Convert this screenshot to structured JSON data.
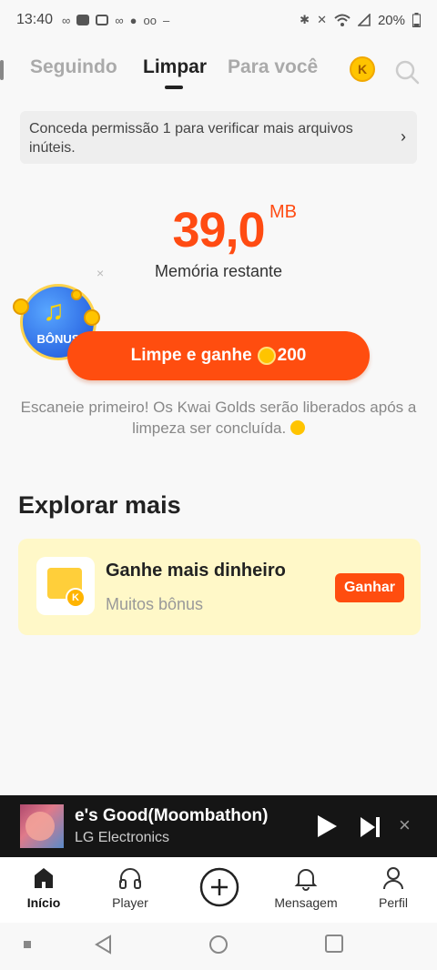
{
  "status_bar": {
    "time": "13:40",
    "battery": "20%"
  },
  "tabs": [
    {
      "label": "Seguindo",
      "active": false
    },
    {
      "label": "Limpar",
      "active": true
    },
    {
      "label": "Para você",
      "active": false
    }
  ],
  "header": {
    "coin_icon": "kwai-coin-icon",
    "coin_letter": "K",
    "search_icon": "search-icon"
  },
  "permission_banner": {
    "text": "Conceda permissão 1 para verificar mais arquivos inúteis.",
    "chevron": "›"
  },
  "memory": {
    "value": "39,0",
    "unit": "MB",
    "label": "Memória restante"
  },
  "bonus_badge": {
    "label": "BÔNUS",
    "icon": "music-note-icon",
    "dismiss": "×"
  },
  "clean_button": {
    "label": "Limpe e ganhe",
    "amount": "200"
  },
  "scan_note": "Escaneie primeiro! Os Kwai Golds serão liberados após a limpeza ser concluída.",
  "explore": {
    "title": "Explorar mais",
    "card": {
      "title": "Ganhe mais dinheiro",
      "subtitle": "Muitos bônus",
      "button": "Ganhar",
      "coin_letter": "K"
    }
  },
  "player": {
    "song": "e's Good(Moombathon)",
    "artist": "LG Electronics",
    "close": "×"
  },
  "bottom_nav": [
    {
      "label": "Início",
      "icon": "home-icon",
      "active": true
    },
    {
      "label": "Player",
      "icon": "headphones-icon",
      "active": false
    },
    {
      "label": "Mensagem",
      "icon": "bell-icon",
      "active": false
    },
    {
      "label": "Perfil",
      "icon": "person-icon",
      "active": false
    }
  ],
  "colors": {
    "accent": "#ff4d0f",
    "memory_value": "#ff4b12",
    "card_bg": "#fff8c8",
    "player_bg": "#151515"
  }
}
